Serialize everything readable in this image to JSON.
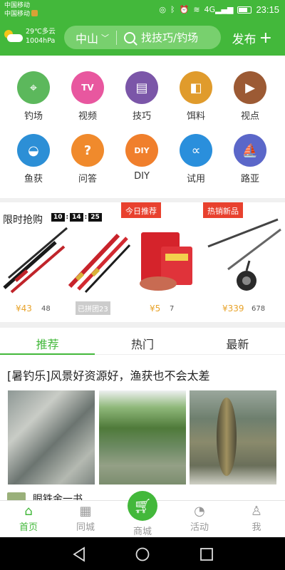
{
  "status_bar": {
    "carrier_line1": "中国移动",
    "carrier_line2": "中国移动",
    "network": "4G",
    "time": "23:15"
  },
  "header": {
    "weather": {
      "temp_desc": "29℃多云",
      "pressure": "1004hPa",
      "icon": "partly-cloudy-icon"
    },
    "city": "中山",
    "search_placeholder": "找技巧/钓场",
    "publish_label": "发布"
  },
  "categories": [
    {
      "label": "钓场",
      "icon": "location-pin-icon",
      "color": "#5cb85c",
      "glyph": "⌖"
    },
    {
      "label": "视频",
      "icon": "tv-icon",
      "color": "#e8579f",
      "glyph": "TV"
    },
    {
      "label": "技巧",
      "icon": "book-icon",
      "color": "#7b56a8",
      "glyph": "▤"
    },
    {
      "label": "饵料",
      "icon": "bait-icon",
      "color": "#e09b2c",
      "glyph": "◧"
    },
    {
      "label": "视点",
      "icon": "play-icon",
      "color": "#9c5a34",
      "glyph": "▶"
    },
    {
      "label": "鱼获",
      "icon": "catch-icon",
      "color": "#2c8fd6",
      "glyph": "◒"
    },
    {
      "label": "问答",
      "icon": "question-icon",
      "color": "#f08a2c",
      "glyph": "?"
    },
    {
      "label": "DIY",
      "icon": "diy-icon",
      "color": "#f07f2c",
      "glyph": "DIY"
    },
    {
      "label": "试用",
      "icon": "fish-hook-icon",
      "color": "#2a8fdc",
      "glyph": "∝"
    },
    {
      "label": "路亚",
      "icon": "boat-icon",
      "color": "#5b67c9",
      "glyph": "⛵"
    }
  ],
  "flash_sale": {
    "title": "限时抢购",
    "timer": {
      "h": "10",
      "m": "14",
      "s": "25"
    },
    "tag_today": "今日推荐",
    "tag_hot": "热销新品",
    "grey_tag": "已拼团23",
    "products": [
      {
        "price": "¥43",
        "orig": "48"
      },
      {
        "price": "",
        "orig": ""
      },
      {
        "price": "¥5",
        "orig": "7"
      },
      {
        "price": "¥339",
        "orig": "678"
      }
    ]
  },
  "tabs": [
    "推荐",
    "热门",
    "最新"
  ],
  "feed": {
    "title": "[暑钓乐]风景好资源好，渔获也不会太差",
    "next_title": "眼铁金一书"
  },
  "bottom_nav": [
    {
      "label": "首页",
      "icon": "home-icon"
    },
    {
      "label": "同城",
      "icon": "building-icon"
    },
    {
      "label": "商城",
      "icon": "cart-icon"
    },
    {
      "label": "活动",
      "icon": "activity-icon"
    },
    {
      "label": "我",
      "icon": "user-icon"
    }
  ],
  "colors": {
    "brand": "#43b83b",
    "price": "#e8a32a",
    "tag": "#e8412e"
  }
}
